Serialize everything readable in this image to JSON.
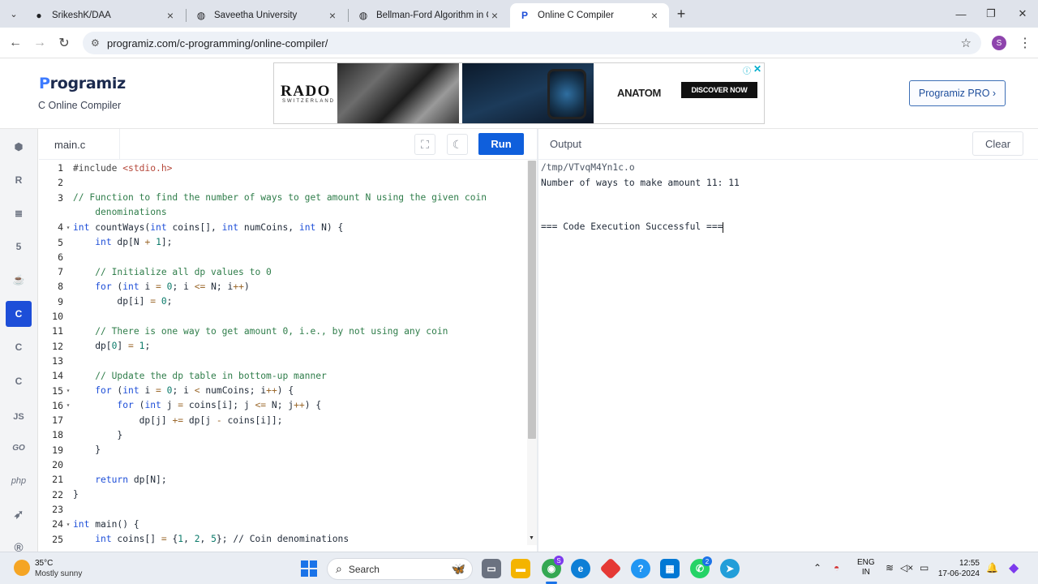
{
  "browser": {
    "tabs": [
      {
        "label": "SrikeshK/DAA",
        "icon": "github-icon"
      },
      {
        "label": "Saveetha University",
        "icon": "globe-icon"
      },
      {
        "label": "Bellman-Ford Algorithm in C",
        "icon": "globe-icon"
      },
      {
        "label": "Online C Compiler",
        "icon": "programiz-icon"
      }
    ],
    "active_tab": 3,
    "url": "programiz.com/c-programming/online-compiler/",
    "profile_initial": "S"
  },
  "site": {
    "logo_text": "rogramiz",
    "logo_initial": "P",
    "subtitle": "C Online Compiler",
    "pro_button": "Programiz PRO ›",
    "ad": {
      "brand": "RADO",
      "brand_sub": "SWITZERLAND",
      "product": "ANATOM",
      "cta": "DISCOVER NOW"
    }
  },
  "sidebar": {
    "languages": [
      {
        "name": "python",
        "glyph": "⬢"
      },
      {
        "name": "r",
        "glyph": "R"
      },
      {
        "name": "sql",
        "glyph": "≣"
      },
      {
        "name": "html",
        "glyph": "5"
      },
      {
        "name": "java",
        "glyph": "☕"
      },
      {
        "name": "c",
        "glyph": "C"
      },
      {
        "name": "cpp",
        "glyph": "C"
      },
      {
        "name": "csharp",
        "glyph": "C"
      },
      {
        "name": "javascript",
        "glyph": "JS"
      },
      {
        "name": "go",
        "glyph": "GO"
      },
      {
        "name": "php",
        "glyph": "php"
      },
      {
        "name": "swift",
        "glyph": "➶"
      },
      {
        "name": "rust",
        "glyph": "®"
      }
    ],
    "active_index": 5
  },
  "editor": {
    "filename": "main.c",
    "run_label": "Run",
    "lines": [
      {
        "n": "1",
        "fold": "",
        "text": "#include <stdio.h>"
      },
      {
        "n": "2",
        "fold": "",
        "text": ""
      },
      {
        "n": "3",
        "fold": "",
        "text": "// Function to find the number of ways to get amount N using the given coin"
      },
      {
        "n": "",
        "fold": "",
        "text": "    denominations"
      },
      {
        "n": "4",
        "fold": "▾",
        "text": "int countWays(int coins[], int numCoins, int N) {"
      },
      {
        "n": "5",
        "fold": "",
        "text": "    int dp[N + 1];"
      },
      {
        "n": "6",
        "fold": "",
        "text": ""
      },
      {
        "n": "7",
        "fold": "",
        "text": "    // Initialize all dp values to 0"
      },
      {
        "n": "8",
        "fold": "",
        "text": "    for (int i = 0; i <= N; i++)"
      },
      {
        "n": "9",
        "fold": "",
        "text": "        dp[i] = 0;"
      },
      {
        "n": "10",
        "fold": "",
        "text": ""
      },
      {
        "n": "11",
        "fold": "",
        "text": "    // There is one way to get amount 0, i.e., by not using any coin"
      },
      {
        "n": "12",
        "fold": "",
        "text": "    dp[0] = 1;"
      },
      {
        "n": "13",
        "fold": "",
        "text": ""
      },
      {
        "n": "14",
        "fold": "",
        "text": "    // Update the dp table in bottom-up manner"
      },
      {
        "n": "15",
        "fold": "▾",
        "text": "    for (int i = 0; i < numCoins; i++) {"
      },
      {
        "n": "16",
        "fold": "▾",
        "text": "        for (int j = coins[i]; j <= N; j++) {"
      },
      {
        "n": "17",
        "fold": "",
        "text": "            dp[j] += dp[j - coins[i]];"
      },
      {
        "n": "18",
        "fold": "",
        "text": "        }"
      },
      {
        "n": "19",
        "fold": "",
        "text": "    }"
      },
      {
        "n": "20",
        "fold": "",
        "text": ""
      },
      {
        "n": "21",
        "fold": "",
        "text": "    return dp[N];"
      },
      {
        "n": "22",
        "fold": "",
        "text": "}"
      },
      {
        "n": "23",
        "fold": "",
        "text": ""
      },
      {
        "n": "24",
        "fold": "▾",
        "text": "int main() {"
      },
      {
        "n": "25",
        "fold": "",
        "text": "    int coins[] = {1, 2, 5}; // Coin denominations"
      }
    ]
  },
  "output": {
    "title": "Output",
    "clear_label": "Clear",
    "lines": [
      "/tmp/VTvqM4Yn1c.o",
      "Number of ways to make amount 11: 11",
      "",
      "",
      "=== Code Execution Successful ==="
    ]
  },
  "taskbar": {
    "temperature": "35°C",
    "condition": "Mostly sunny",
    "search_placeholder": "Search",
    "language": "ENG",
    "region": "IN",
    "time": "12:55",
    "date": "17-06-2024",
    "whatsapp_badge": "2",
    "chrome_badge": "S"
  },
  "colors": {
    "accent": "#0f5fdc",
    "active_lang": "#1d4ed8"
  }
}
